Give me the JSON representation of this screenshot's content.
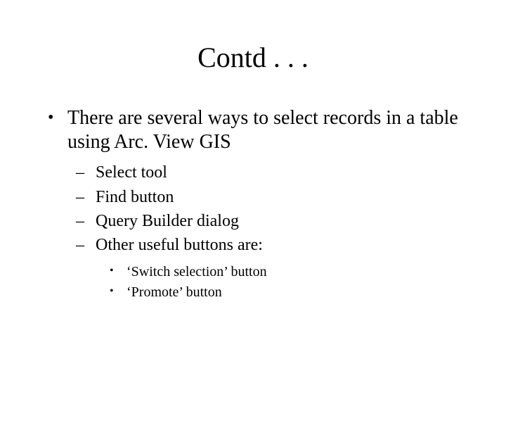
{
  "title": "Contd . . .",
  "bullets": {
    "level1": {
      "text": "There are several ways to select records in a table using Arc. View GIS"
    },
    "level2": [
      {
        "text": "Select tool"
      },
      {
        "text": "Find button"
      },
      {
        "text": "Query Builder dialog"
      },
      {
        "text": "Other useful buttons are:"
      }
    ],
    "level3": [
      {
        "text": "‘Switch selection’ button"
      },
      {
        "text": "‘Promote’ button"
      }
    ]
  }
}
